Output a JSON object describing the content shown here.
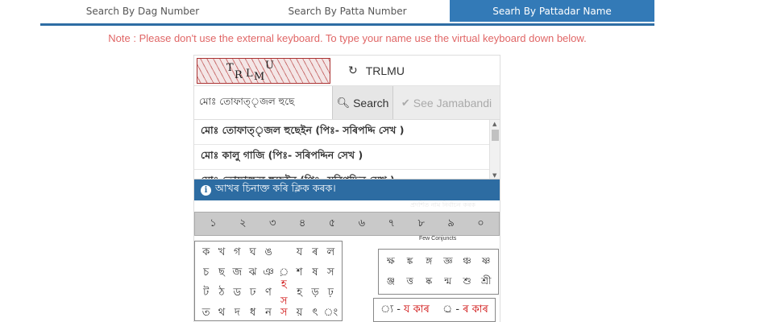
{
  "tabs": [
    {
      "label": "Search By Dag Number"
    },
    {
      "label": "Search By Patta Number"
    },
    {
      "label": "Searh By Pattadar Name"
    }
  ],
  "note": "Note : Please don't use the external keyboard. To type your name use the virtual keyboard down below.",
  "captcha": {
    "image_chars": [
      "T",
      "R",
      "L",
      "M",
      "U"
    ],
    "refresh_icon": "refresh-icon",
    "text": "TRLMU"
  },
  "search": {
    "input_value": "মোঃ তোফাত্ৃজল হুছে",
    "search_label": "Search",
    "search_icon": "search-icon",
    "jamabandi_label": "See Jamabandi",
    "jamabandi_icon": "check-icon"
  },
  "results": [
    "মোঃ তোফাত্ৃজল হুছেইন (পিঃ- সৰিপদ্দি সেখ )",
    "মোঃ কালু গাজি (পিঃ- সৰিপদ্দিন সেখ )",
    "মোঃ তোফাজ্জল হুছেইন (পিঃ- সৰিপদ্দিন সেখ )"
  ],
  "info": {
    "icon": "info-icon",
    "text": "আখৰ চিনাক্ত কৰি ক্লিক কৰক।",
    "subtext": "প্ৰদৰ্শিত নাম নিৰ্বাচন কৰক"
  },
  "digits": [
    "১",
    "২",
    "৩",
    "৪",
    "৫",
    "৬",
    "৭",
    "৮",
    "৯",
    "০"
  ],
  "keyboard": {
    "consonant_rows": [
      [
        {
          "c": "ক"
        },
        {
          "c": "খ"
        },
        {
          "c": "গ"
        },
        {
          "c": "ঘ"
        },
        {
          "c": "ঙ"
        },
        {
          "c": ""
        },
        {
          "c": "য"
        },
        {
          "c": "ৰ"
        },
        {
          "c": "ল"
        }
      ],
      [
        {
          "c": "চ"
        },
        {
          "c": "ছ"
        },
        {
          "c": "জ"
        },
        {
          "c": "ঝ"
        },
        {
          "c": "ঞ"
        },
        {
          "c": "়"
        },
        {
          "c": "শ"
        },
        {
          "c": "ষ"
        },
        {
          "c": "স"
        }
      ],
      [
        {
          "c": "ট"
        },
        {
          "c": "ঠ"
        },
        {
          "c": "ড"
        },
        {
          "c": "ঢ"
        },
        {
          "c": "ণ"
        },
        {
          "c": "হ স",
          "red": true
        },
        {
          "c": "হ"
        },
        {
          "c": "ড়"
        },
        {
          "c": "ঢ়"
        }
      ],
      [
        {
          "c": "ত"
        },
        {
          "c": "থ"
        },
        {
          "c": "দ"
        },
        {
          "c": "ধ"
        },
        {
          "c": "ন"
        },
        {
          "c": "স",
          "red": true
        },
        {
          "c": "য়"
        },
        {
          "c": "ৎ"
        },
        {
          "c": "ং"
        }
      ]
    ],
    "conjunct_title": "Few Conjuncts",
    "conjunct_rows": [
      [
        "ক্ষ",
        "ঙ্ক",
        "ঙ্গ",
        "জ্ঞ",
        "ঞ্চ",
        "ষ্ণ"
      ],
      [
        "ঞ্জ",
        "ত্ত",
        "ষ্ক",
        "ন্ম",
        "শু",
        "শ্রী"
      ]
    ],
    "ya_phala": "্য",
    "ya_label": "য কাৰ",
    "ra_phala": "্ৰ",
    "ra_label": "ৰ কাৰ"
  }
}
